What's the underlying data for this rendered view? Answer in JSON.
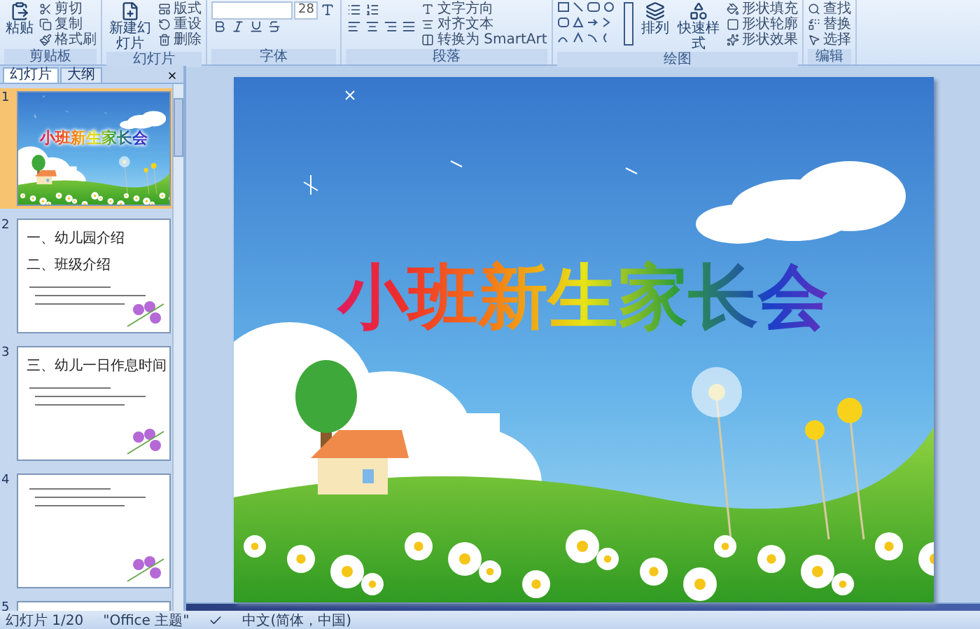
{
  "ribbon": {
    "groups": [
      {
        "label": "剪贴板",
        "kind": "buttons",
        "large": [
          "粘贴"
        ],
        "items": [
          "剪切",
          "复制",
          "格式刷"
        ]
      },
      {
        "label": "幻灯片",
        "kind": "buttons",
        "large": [
          "新建幻灯片"
        ],
        "items": [
          "版式",
          "重设",
          "删除"
        ]
      },
      {
        "label": "字体",
        "kind": "font",
        "size": "28"
      },
      {
        "label": "段落",
        "kind": "paragraph",
        "items": [
          "文字方向",
          "对齐文本",
          "转换为 SmartArt"
        ]
      },
      {
        "label": "绘图",
        "kind": "drawing",
        "large": [
          "排列",
          "快速样式"
        ],
        "items": [
          "形状填充",
          "形状轮廓",
          "形状效果"
        ]
      },
      {
        "label": "编辑",
        "kind": "buttons",
        "items": [
          "查找",
          "替换",
          "选择"
        ]
      }
    ]
  },
  "panel": {
    "tabs": [
      {
        "label": "幻灯片",
        "selected": true
      },
      {
        "label": "大纲",
        "selected": false
      }
    ],
    "thumbnails": [
      {
        "number": "1",
        "selected": true,
        "kind": "title",
        "title": "小班新生家长会"
      },
      {
        "number": "2",
        "selected": false,
        "kind": "text",
        "lines": [
          "一、幼儿园介绍",
          "二、班级介绍"
        ]
      },
      {
        "number": "3",
        "selected": false,
        "kind": "text",
        "lines": [
          "三、幼儿一日作息时间"
        ]
      },
      {
        "number": "4",
        "selected": false,
        "kind": "text"
      },
      {
        "number": "5",
        "selected": false,
        "kind": "text"
      }
    ]
  },
  "slide": {
    "title": "小班新生家长会"
  },
  "status_bar": {
    "slide": "幻灯片 1/20",
    "theme": "\"Office 主题\"",
    "language": "中文(简体，中国)"
  }
}
